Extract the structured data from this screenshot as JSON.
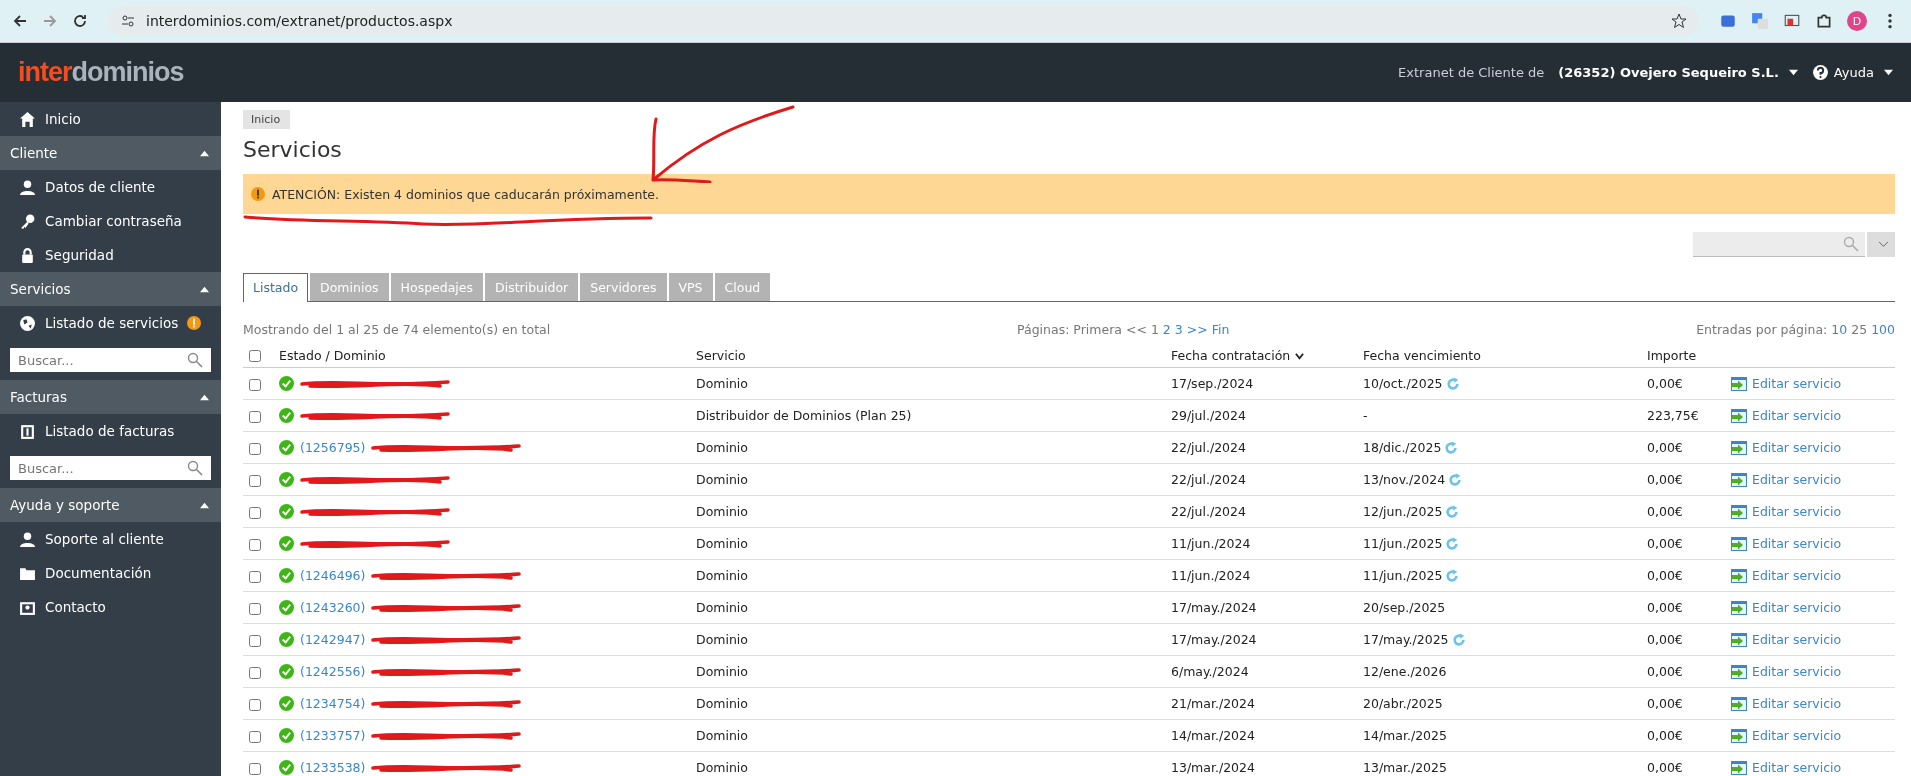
{
  "browser": {
    "url": "interdominios.com/extranet/productos.aspx",
    "avatar": "D"
  },
  "header": {
    "logo_a": "inter",
    "logo_b": "dominios",
    "client_label": "Extranet de Cliente de",
    "client_name": "(26352) Ovejero Sequeiro S.L.",
    "help": "Ayuda"
  },
  "sidebar": {
    "items": [
      {
        "kind": "link",
        "label": "Inicio",
        "alert": false
      },
      {
        "kind": "section",
        "label": "Cliente"
      },
      {
        "kind": "link",
        "label": "Datos de cliente",
        "alert": false
      },
      {
        "kind": "link",
        "label": "Cambiar contraseña",
        "alert": false
      },
      {
        "kind": "link",
        "label": "Seguridad",
        "alert": false
      },
      {
        "kind": "section",
        "label": "Servicios"
      },
      {
        "kind": "link",
        "label": "Listado de servicios",
        "alert": true
      },
      {
        "kind": "search",
        "placeholder": "Buscar..."
      },
      {
        "kind": "section",
        "label": "Facturas"
      },
      {
        "kind": "link",
        "label": "Listado de facturas",
        "alert": false
      },
      {
        "kind": "search",
        "placeholder": "Buscar..."
      },
      {
        "kind": "section",
        "label": "Ayuda y soporte"
      },
      {
        "kind": "link",
        "label": "Soporte al cliente",
        "alert": false
      },
      {
        "kind": "link",
        "label": "Documentación",
        "alert": false
      },
      {
        "kind": "link",
        "label": "Contacto",
        "alert": false
      }
    ]
  },
  "breadcrumb": "Inicio",
  "title": "Servicios",
  "alert": "ATENCIÓN: Existen 4 dominios que caducarán próximamente.",
  "tabs": [
    {
      "label": "Listado",
      "selected": true
    },
    {
      "label": "Dominios",
      "selected": false
    },
    {
      "label": "Hospedajes",
      "selected": false
    },
    {
      "label": "Distribuidor",
      "selected": false
    },
    {
      "label": "Servidores",
      "selected": false
    },
    {
      "label": "VPS",
      "selected": false
    },
    {
      "label": "Cloud",
      "selected": false
    }
  ],
  "summary": "Mostrando del 1 al 25 de 74 elemento(s) en total",
  "pager": {
    "label": "Páginas: Primera <<",
    "pages": [
      {
        "label": "1",
        "selected": true
      },
      {
        "label": "2",
        "selected": false
      },
      {
        "label": "3",
        "selected": false
      }
    ],
    "last": ">> Fin"
  },
  "per_page": {
    "label": "Entradas por página:",
    "options": [
      {
        "label": "10",
        "selected": false
      },
      {
        "label": "25",
        "selected": true
      },
      {
        "label": "100",
        "selected": false
      }
    ]
  },
  "table": {
    "select_all_checked": false,
    "columns": [
      "Estado / Dominio",
      "Servicio",
      "Fecha contratación",
      "Fecha vencimiento",
      "Importe"
    ],
    "rows": [
      {
        "checked": false,
        "service": "Dominio",
        "start": "17/sep./2024",
        "end": "10/oct./2025",
        "renew": true,
        "amount": "0,00€",
        "action": "Editar servicio"
      },
      {
        "checked": false,
        "service": "Distribuidor de Dominios (Plan 25)",
        "start": "29/jul./2024",
        "end": "-",
        "renew": false,
        "amount": "223,75€",
        "action": "Editar servicio"
      },
      {
        "checked": false,
        "domain": "(1256795)",
        "service": "Dominio",
        "start": "22/jul./2024",
        "end": "18/dic./2025",
        "renew": true,
        "amount": "0,00€",
        "action": "Editar servicio"
      },
      {
        "checked": false,
        "service": "Dominio",
        "start": "22/jul./2024",
        "end": "13/nov./2024",
        "renew": true,
        "amount": "0,00€",
        "action": "Editar servicio"
      },
      {
        "checked": false,
        "service": "Dominio",
        "start": "22/jul./2024",
        "end": "12/jun./2025",
        "renew": true,
        "amount": "0,00€",
        "action": "Editar servicio"
      },
      {
        "checked": false,
        "service": "Dominio",
        "start": "11/jun./2024",
        "end": "11/jun./2025",
        "renew": true,
        "amount": "0,00€",
        "action": "Editar servicio"
      },
      {
        "checked": false,
        "domain": "(1246496)",
        "service": "Dominio",
        "start": "11/jun./2024",
        "end": "11/jun./2025",
        "renew": true,
        "amount": "0,00€",
        "action": "Editar servicio"
      },
      {
        "checked": false,
        "domain": "(1243260)",
        "service": "Dominio",
        "start": "17/may./2024",
        "end": "20/sep./2025",
        "renew": false,
        "amount": "0,00€",
        "action": "Editar servicio"
      },
      {
        "checked": false,
        "domain": "(1242947)",
        "service": "Dominio",
        "start": "17/may./2024",
        "end": "17/may./2025",
        "renew": true,
        "amount": "0,00€",
        "action": "Editar servicio"
      },
      {
        "checked": false,
        "domain": "(1242556)",
        "service": "Dominio",
        "start": "6/may./2024",
        "end": "12/ene./2026",
        "renew": false,
        "amount": "0,00€",
        "action": "Editar servicio"
      },
      {
        "checked": false,
        "domain": "(1234754)",
        "service": "Dominio",
        "start": "21/mar./2024",
        "end": "20/abr./2025",
        "renew": false,
        "amount": "0,00€",
        "action": "Editar servicio"
      },
      {
        "checked": false,
        "domain": "(1233757)",
        "service": "Dominio",
        "start": "14/mar./2024",
        "end": "14/mar./2025",
        "renew": false,
        "amount": "0,00€",
        "action": "Editar servicio"
      },
      {
        "checked": false,
        "domain": "(1233538)",
        "service": "Dominio",
        "start": "13/mar./2024",
        "end": "13/mar./2025",
        "renew": false,
        "amount": "0,00€",
        "action": "Editar servicio"
      }
    ]
  }
}
